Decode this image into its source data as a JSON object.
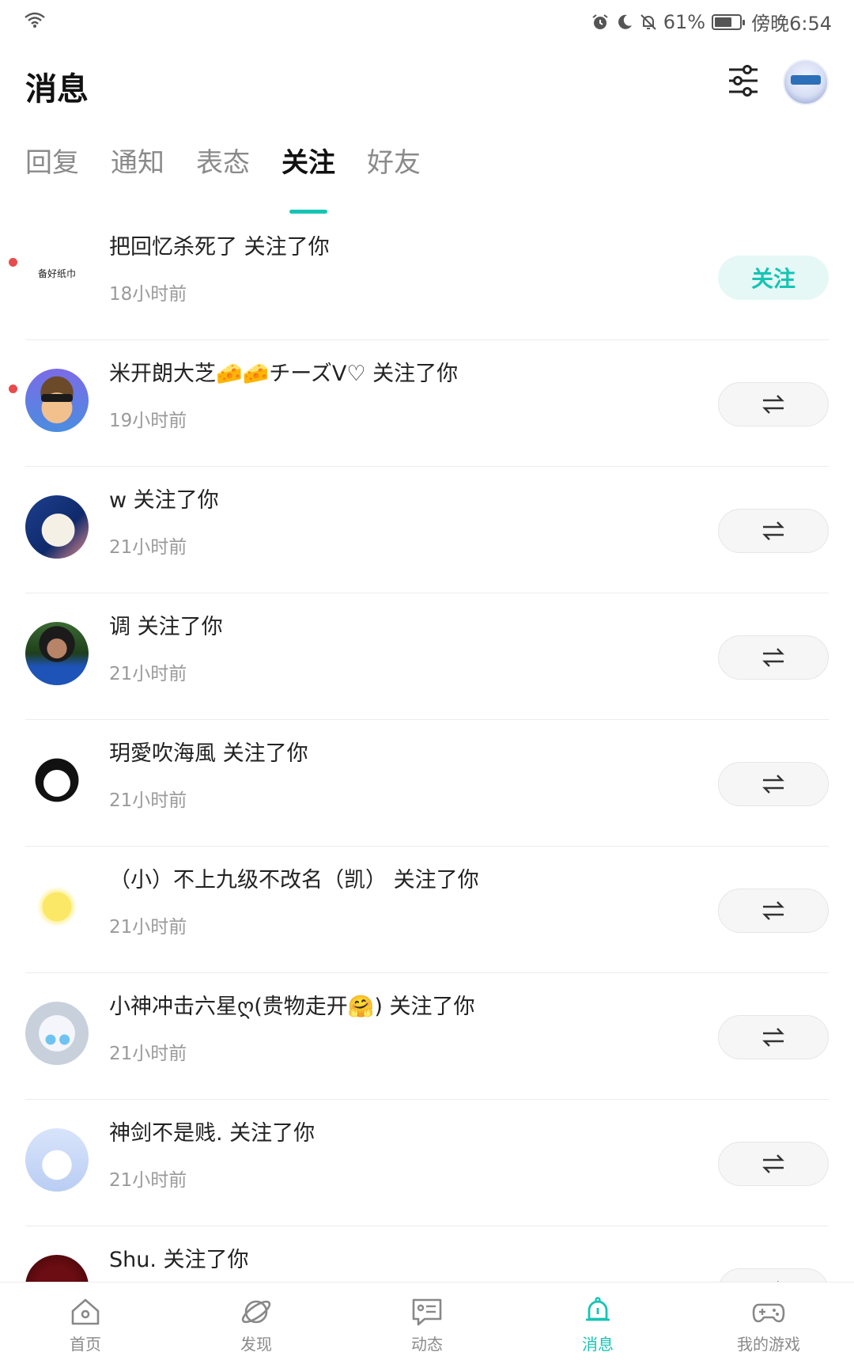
{
  "status_bar": {
    "battery": "61%",
    "battery_level": 0.61,
    "time": "傍晚6:54"
  },
  "header": {
    "title": "消息"
  },
  "tabs": [
    {
      "label": "回复",
      "active": false
    },
    {
      "label": "通知",
      "active": false
    },
    {
      "label": "表态",
      "active": false
    },
    {
      "label": "关注",
      "active": true
    },
    {
      "label": "好友",
      "active": false
    }
  ],
  "notifications": [
    {
      "text": "把回忆杀死了 关注了你",
      "time": "18小时前",
      "avatar_text": "备好纸巾",
      "unread": true,
      "button": "follow",
      "button_label": "关注"
    },
    {
      "text": "米开朗大芝🧀🧀チーズV♡ 关注了你",
      "time": "19小时前",
      "unread": true,
      "button": "mutual"
    },
    {
      "text": "w 关注了你",
      "time": "21小时前",
      "unread": false,
      "button": "mutual"
    },
    {
      "text": "调 关注了你",
      "time": "21小时前",
      "unread": false,
      "button": "mutual"
    },
    {
      "text": "玥愛吹海風 关注了你",
      "time": "21小时前",
      "unread": false,
      "button": "mutual"
    },
    {
      "text": "（小）不上九级不改名（凯） 关注了你",
      "time": "21小时前",
      "unread": false,
      "button": "mutual"
    },
    {
      "text": "小神冲击六星ღ(贵物走开🤗) 关注了你",
      "time": "21小时前",
      "unread": false,
      "button": "mutual"
    },
    {
      "text": "神剑不是贱. 关注了你",
      "time": "21小时前",
      "unread": false,
      "button": "mutual"
    },
    {
      "text": "Shu. 关注了你",
      "time": "",
      "unread": false,
      "button": "mutual"
    }
  ],
  "bottom_nav": [
    {
      "label": "首页",
      "icon": "home-icon",
      "active": false
    },
    {
      "label": "发现",
      "icon": "planet-icon",
      "active": false
    },
    {
      "label": "动态",
      "icon": "feed-icon",
      "active": false
    },
    {
      "label": "消息",
      "icon": "bell-icon",
      "active": true
    },
    {
      "label": "我的游戏",
      "icon": "gamepad-icon",
      "active": false
    }
  ],
  "colors": {
    "accent": "#16c4b4",
    "unread_dot": "#e84b4b"
  }
}
